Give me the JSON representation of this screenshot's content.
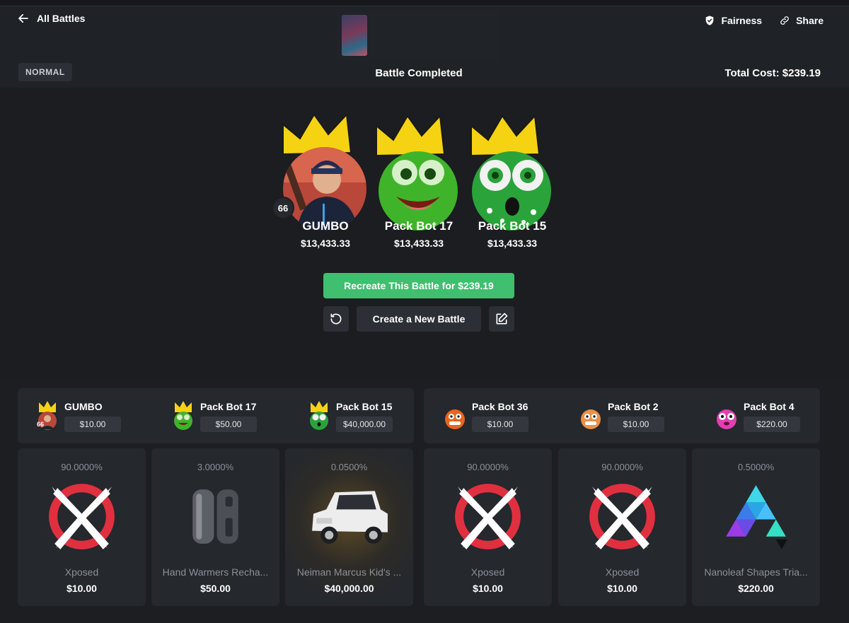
{
  "nav": {
    "back_label": "All Battles"
  },
  "header_actions": {
    "fairness_label": "Fairness",
    "share_label": "Share"
  },
  "battle": {
    "mode": "NORMAL",
    "status": "Battle Completed",
    "total_cost": "Total Cost: $239.19"
  },
  "players": [
    {
      "name": "GUMBO",
      "value": "$13,433.33",
      "level": "66"
    },
    {
      "name": "Pack Bot 17",
      "value": "$13,433.33"
    },
    {
      "name": "Pack Bot 15",
      "value": "$13,433.33"
    }
  ],
  "actions": {
    "recreate_label": "Recreate This Battle for $239.19",
    "new_battle_label": "Create a New Battle"
  },
  "teams": [
    {
      "players": [
        {
          "name": "GUMBO",
          "value": "$10.00",
          "level": "66"
        },
        {
          "name": "Pack Bot 17",
          "value": "$50.00"
        },
        {
          "name": "Pack Bot 15",
          "value": "$40,000.00"
        }
      ]
    },
    {
      "players": [
        {
          "name": "Pack Bot 36",
          "value": "$10.00"
        },
        {
          "name": "Pack Bot 2",
          "value": "$10.00"
        },
        {
          "name": "Pack Bot 4",
          "value": "$220.00"
        }
      ]
    }
  ],
  "items": [
    {
      "chance": "90.0000%",
      "name": "Xposed",
      "price": "$10.00"
    },
    {
      "chance": "3.0000%",
      "name": "Hand Warmers Recha...",
      "price": "$50.00"
    },
    {
      "chance": "0.0500%",
      "name": "Neiman Marcus Kid's ...",
      "price": "$40,000.00"
    },
    {
      "chance": "90.0000%",
      "name": "Xposed",
      "price": "$10.00"
    },
    {
      "chance": "90.0000%",
      "name": "Xposed",
      "price": "$10.00"
    },
    {
      "chance": "0.5000%",
      "name": "Nanoleaf Shapes Tria...",
      "price": "$220.00"
    }
  ],
  "colors": {
    "accent_green": "#3fbf6f",
    "crown_yellow": "#f5d313",
    "xposed_red": "#e0303f"
  }
}
